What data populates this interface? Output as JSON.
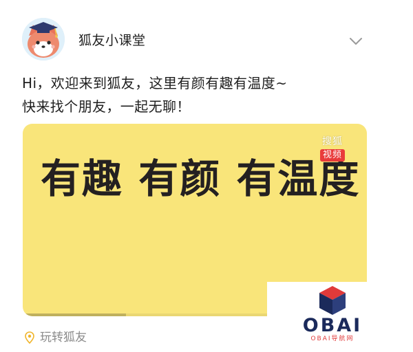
{
  "header": {
    "account_name": "狐友小课堂",
    "avatar_icon": "fox-graduate-avatar",
    "expand_icon": "chevron-down-icon"
  },
  "post": {
    "lines": [
      "Hi，欢迎来到狐友，这里有颜有趣有温度~",
      "快来找个朋友，一起无聊！"
    ]
  },
  "video": {
    "tagline": "有趣 有颜 有温度",
    "watermark_top": "搜狐",
    "watermark_bottom": "视频",
    "background_color": "#f9e57a",
    "progress_fraction": 0.3
  },
  "location": {
    "label": "玩转狐友",
    "icon": "location-pin-icon"
  },
  "badge": {
    "brand": "OBAI",
    "subtitle": "OBAI导航网"
  }
}
